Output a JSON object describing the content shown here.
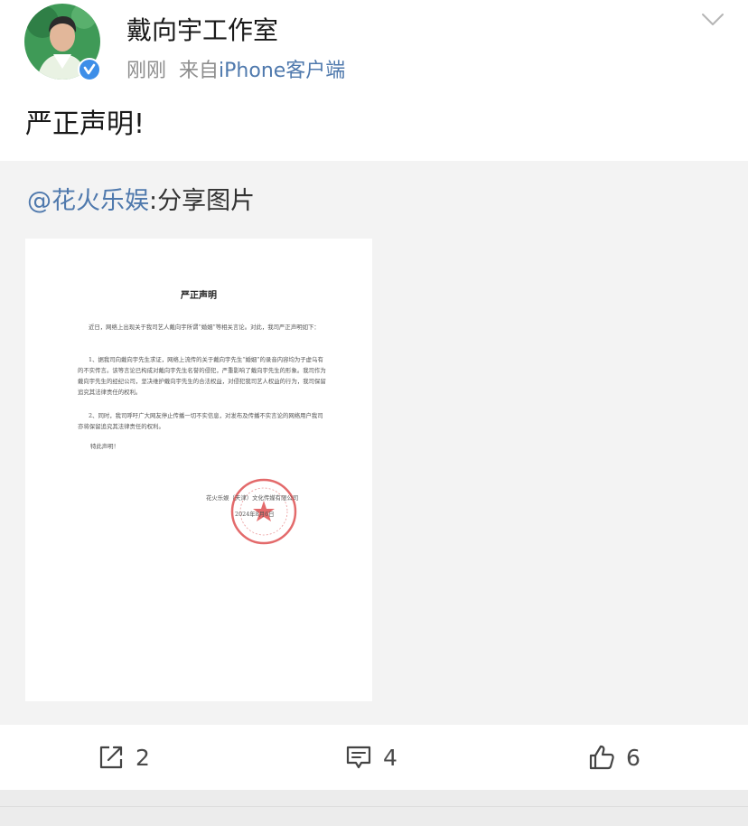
{
  "post": {
    "author": "戴向宇工作室",
    "time": "刚刚",
    "source_prefix": "来自",
    "source": "iPhone客户端",
    "text": "严正声明!"
  },
  "repost": {
    "mention": "@花火乐娱",
    "text": ":分享图片"
  },
  "document": {
    "title": "严正声明",
    "paragraph_1": "近日，网络上出现关于我司艺人戴向宇所谓“婚姻”等相关言论。对此，我司严正声明如下：",
    "paragraph_2": "1、据我司向戴向宇先生求证，网络上流传的关于戴向宇先生“婚姻”的录音内容均为子虚乌有的不实传言。该等言论已构成对戴向宇先生名誉的侵犯，严重影响了戴向宇先生的形象。我司作为戴向宇先生的经纪公司，坚决维护戴向宇先生的合法权益，对侵犯我司艺人权益的行为，我司保留追究其法律责任的权利。",
    "paragraph_3": "2、同时，我司呼吁广大网友停止传播一切不实信息，对发布及传播不实言论的网络用户我司亦将保留追究其法律责任的权利。",
    "closing": "特此声明！",
    "signer": "花火乐娱（天津）文化传媒有限公司",
    "date": "2024年8月6日"
  },
  "actions": {
    "repost_count": "2",
    "comment_count": "4",
    "like_count": "6"
  },
  "colors": {
    "link": "#4f79ad",
    "verified": "#3d8ee8",
    "repost_bg": "#f3f3f3",
    "seal": "#d9383a"
  },
  "icons": {
    "chevron": "chevron-down-icon",
    "verified": "verified-badge-icon",
    "repost": "repost-icon",
    "comment": "comment-icon",
    "like": "like-icon"
  }
}
